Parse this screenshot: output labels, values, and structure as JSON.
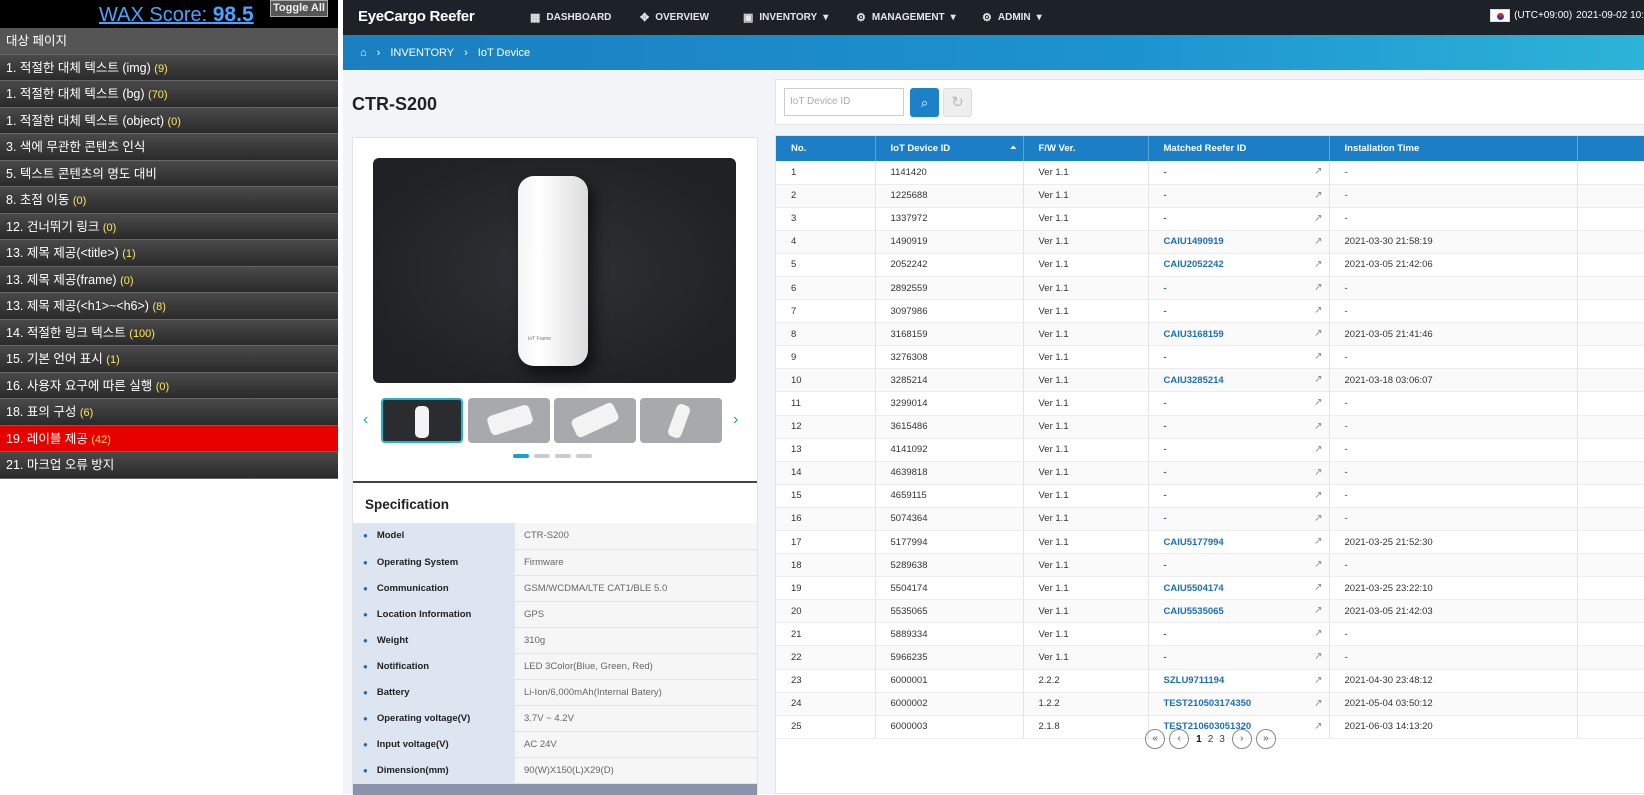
{
  "wax": {
    "score_label": "WAX Score:",
    "score_value": "98.5",
    "toggle_label": "Toggle All",
    "header": "대상 페이지",
    "items": [
      {
        "label": "1. 적절한 대체 텍스트 (img)",
        "count": "(9)"
      },
      {
        "label": "1. 적절한 대체 텍스트 (bg)",
        "count": "(70)"
      },
      {
        "label": "1. 적절한 대체 텍스트 (object)",
        "count": "(0)"
      },
      {
        "label": "3. 색에 무관한 콘텐츠 인식",
        "count": ""
      },
      {
        "label": "5. 텍스트 콘텐츠의 명도 대비",
        "count": ""
      },
      {
        "label": "8. 초점 이동",
        "count": "(0)"
      },
      {
        "label": "12. 건너뛰기 링크",
        "count": "(0)"
      },
      {
        "label": "13. 제목 제공(<title>)",
        "count": "(1)"
      },
      {
        "label": "13. 제목 제공(frame)",
        "count": "(0)"
      },
      {
        "label": "13. 제목 제공(<h1>~<h6>)",
        "count": "(8)"
      },
      {
        "label": "14. 적절한 링크 텍스트",
        "count": "(100)"
      },
      {
        "label": "15. 기본 언어 표시",
        "count": "(1)"
      },
      {
        "label": "16. 사용자 요구에 따른 실행",
        "count": "(0)"
      },
      {
        "label": "18. 표의 구성",
        "count": "(6)"
      },
      {
        "label": "19. 레이블 제공",
        "count": "(42)",
        "active": true
      },
      {
        "label": "21. 마크업 오류 방지",
        "count": ""
      }
    ]
  },
  "nav": {
    "logo": "EyeCargo Reefer",
    "items": [
      "DASHBOARD",
      "OVERVIEW",
      "INVENTORY",
      "MANAGEMENT",
      "ADMIN"
    ],
    "timezone": "(UTC+09:00)",
    "datetime": "2021-09-02 10:"
  },
  "breadcrumb": [
    "INVENTORY",
    "IoT Device"
  ],
  "page_title": "CTR-S200",
  "device_label": "IoT Frame",
  "spec": {
    "title": "Specification",
    "rows": [
      {
        "k": "Model",
        "v": "CTR-S200"
      },
      {
        "k": "Operating System",
        "v": "Firmware"
      },
      {
        "k": "Communication",
        "v": "GSM/WCDMA/LTE CAT1/BLE 5.0"
      },
      {
        "k": "Location Information",
        "v": "GPS"
      },
      {
        "k": "Weight",
        "v": "310g"
      },
      {
        "k": "Notification",
        "v": "LED 3Color(Blue, Green, Red)"
      },
      {
        "k": "Battery",
        "v": "Li-Ion/6,000mAh(Internal Batery)"
      },
      {
        "k": "Operating voltage(V)",
        "v": "3.7V ~ 4.2V"
      },
      {
        "k": "Input voltage(V)",
        "v": "AC 24V"
      },
      {
        "k": "Dimension(mm)",
        "v": "90(W)X150(L)X29(D)"
      }
    ]
  },
  "search": {
    "placeholder": "IoT Device ID"
  },
  "table": {
    "columns": [
      "No.",
      "IoT Device ID",
      "F/W Ver.",
      "Matched Reefer ID",
      "Installation Time"
    ],
    "rows": [
      [
        "1",
        "1141420",
        "Ver 1.1",
        "-",
        "-"
      ],
      [
        "2",
        "1225688",
        "Ver 1.1",
        "-",
        "-"
      ],
      [
        "3",
        "1337972",
        "Ver 1.1",
        "-",
        "-"
      ],
      [
        "4",
        "1490919",
        "Ver 1.1",
        "CAIU1490919",
        "2021-03-30 21:58:19"
      ],
      [
        "5",
        "2052242",
        "Ver 1.1",
        "CAIU2052242",
        "2021-03-05 21:42:06"
      ],
      [
        "6",
        "2892559",
        "Ver 1.1",
        "-",
        "-"
      ],
      [
        "7",
        "3097986",
        "Ver 1.1",
        "-",
        "-"
      ],
      [
        "8",
        "3168159",
        "Ver 1.1",
        "CAIU3168159",
        "2021-03-05 21:41:46"
      ],
      [
        "9",
        "3276308",
        "Ver 1.1",
        "-",
        "-"
      ],
      [
        "10",
        "3285214",
        "Ver 1.1",
        "CAIU3285214",
        "2021-03-18 03:06:07"
      ],
      [
        "11",
        "3299014",
        "Ver 1.1",
        "-",
        "-"
      ],
      [
        "12",
        "3615486",
        "Ver 1.1",
        "-",
        "-"
      ],
      [
        "13",
        "4141092",
        "Ver 1.1",
        "-",
        "-"
      ],
      [
        "14",
        "4639818",
        "Ver 1.1",
        "-",
        "-"
      ],
      [
        "15",
        "4659115",
        "Ver 1.1",
        "-",
        "-"
      ],
      [
        "16",
        "5074364",
        "Ver 1.1",
        "-",
        "-"
      ],
      [
        "17",
        "5177994",
        "Ver 1.1",
        "CAIU5177994",
        "2021-03-25 21:52:30"
      ],
      [
        "18",
        "5289638",
        "Ver 1.1",
        "-",
        "-"
      ],
      [
        "19",
        "5504174",
        "Ver 1.1",
        "CAIU5504174",
        "2021-03-25 23:22:10"
      ],
      [
        "20",
        "5535065",
        "Ver 1.1",
        "CAIU5535065",
        "2021-03-05 21:42:03"
      ],
      [
        "21",
        "5889334",
        "Ver 1.1",
        "-",
        "-"
      ],
      [
        "22",
        "5966235",
        "Ver 1.1",
        "-",
        "-"
      ],
      [
        "23",
        "6000001",
        "2.2.2",
        "SZLU9711194",
        "2021-04-30 23:48:12"
      ],
      [
        "24",
        "6000002",
        "1.2.2",
        "TEST210503174350",
        "2021-05-04 03:50:12"
      ],
      [
        "25",
        "6000003",
        "2.1.8",
        "TEST210603051320",
        "2021-06-03 14:13:20"
      ]
    ]
  },
  "pager": {
    "pages": [
      "1",
      "2",
      "3"
    ],
    "current": "1"
  }
}
